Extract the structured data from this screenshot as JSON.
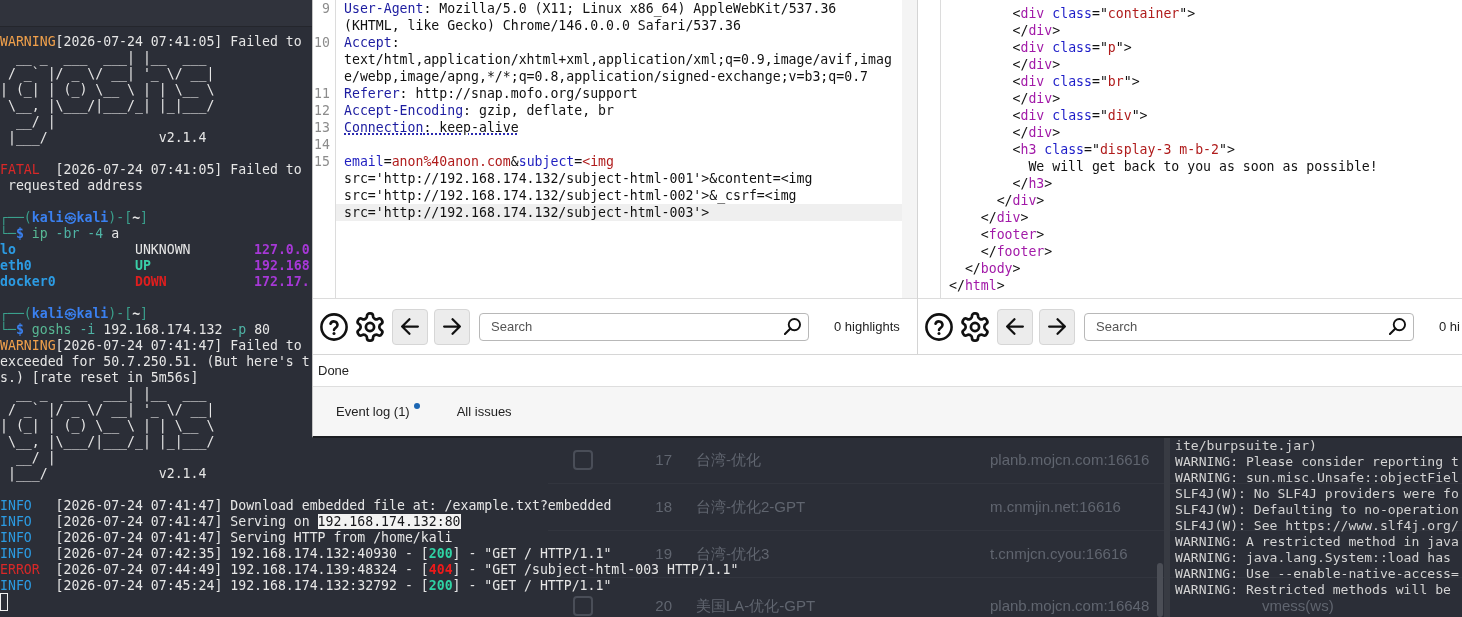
{
  "left_terminal": {
    "lines": [
      {
        "kind": "text",
        "segments": [
          {
            "kind": "warning",
            "text": "WARNING"
          },
          {
            "kind": "plain",
            "text": "[2026-07-24 07:41:05] Failed to"
          }
        ]
      },
      {
        "kind": "text",
        "segments": [
          {
            "kind": "plain",
            "text": "  __ _  ___  ___| |__  ___"
          }
        ]
      },
      {
        "kind": "text",
        "segments": [
          {
            "kind": "plain",
            "text": " / _` |/ _ \\/ __| '_ \\/ __|"
          }
        ]
      },
      {
        "kind": "text",
        "segments": [
          {
            "kind": "plain",
            "text": "| (_| | (_) \\__ \\ | | \\__ \\"
          }
        ]
      },
      {
        "kind": "text",
        "segments": [
          {
            "kind": "plain",
            "text": " \\__, |\\___/|___/_| |_|___/"
          }
        ]
      },
      {
        "kind": "text",
        "segments": [
          {
            "kind": "plain",
            "text": "  __/ |"
          }
        ]
      },
      {
        "kind": "text",
        "segments": [
          {
            "kind": "plain",
            "text": " |___/              v2.1.4"
          }
        ]
      },
      {
        "kind": "blank"
      },
      {
        "kind": "text",
        "segments": [
          {
            "kind": "fatal",
            "text": "FATAL"
          },
          {
            "kind": "plain",
            "text": "  [2026-07-24 07:41:05] Failed to"
          }
        ]
      },
      {
        "kind": "text",
        "segments": [
          {
            "kind": "plain",
            "text": " requested address"
          }
        ]
      },
      {
        "kind": "blank"
      },
      {
        "kind": "text",
        "segments": [
          {
            "kind": "frame",
            "text": "┌──("
          },
          {
            "kind": "host",
            "text": "kali㉿kali"
          },
          {
            "kind": "frame",
            "text": ")-["
          },
          {
            "kind": "cwd",
            "text": "~"
          },
          {
            "kind": "frame",
            "text": "]"
          }
        ]
      },
      {
        "kind": "text",
        "segments": [
          {
            "kind": "frame",
            "text": "└─"
          },
          {
            "kind": "dollar",
            "text": "$ "
          },
          {
            "kind": "command",
            "text": "ip"
          },
          {
            "kind": "option",
            "text": " -br -4"
          },
          {
            "kind": "plain",
            "text": " a"
          }
        ]
      },
      {
        "kind": "text",
        "segments": [
          {
            "kind": "iface",
            "text": "lo"
          },
          {
            "kind": "plain",
            "text": "               UNKNOWN        "
          },
          {
            "kind": "address",
            "text": "127.0.0"
          }
        ]
      },
      {
        "kind": "text",
        "segments": [
          {
            "kind": "iface",
            "text": "eth0             "
          },
          {
            "kind": "up",
            "text": "UP             "
          },
          {
            "kind": "address",
            "text": "192.168"
          }
        ]
      },
      {
        "kind": "text",
        "segments": [
          {
            "kind": "iface",
            "text": "docker0          "
          },
          {
            "kind": "down",
            "text": "DOWN           "
          },
          {
            "kind": "address",
            "text": "172.17."
          }
        ]
      },
      {
        "kind": "blank"
      },
      {
        "kind": "text",
        "segments": [
          {
            "kind": "frame",
            "text": "┌──("
          },
          {
            "kind": "host",
            "text": "kali㉿kali"
          },
          {
            "kind": "frame",
            "text": ")-["
          },
          {
            "kind": "cwd",
            "text": "~"
          },
          {
            "kind": "frame",
            "text": "]"
          }
        ]
      },
      {
        "kind": "text",
        "segments": [
          {
            "kind": "frame",
            "text": "└─"
          },
          {
            "kind": "dollar",
            "text": "$ "
          },
          {
            "kind": "command",
            "text": "goshs"
          },
          {
            "kind": "option",
            "text": " -i"
          },
          {
            "kind": "plain",
            "text": " 192.168.174.132"
          },
          {
            "kind": "option",
            "text": " -p"
          },
          {
            "kind": "plain",
            "text": " 80"
          }
        ]
      },
      {
        "kind": "text",
        "segments": [
          {
            "kind": "warning",
            "text": "WARNING"
          },
          {
            "kind": "plain",
            "text": "[2026-07-24 07:41:47] Failed to"
          }
        ]
      },
      {
        "kind": "text",
        "segments": [
          {
            "kind": "plain",
            "text": "exceeded for 50.7.250.51. (But here's t"
          }
        ]
      },
      {
        "kind": "text",
        "segments": [
          {
            "kind": "plain",
            "text": "s.) [rate reset in 5m56s]"
          }
        ]
      },
      {
        "kind": "text",
        "segments": [
          {
            "kind": "plain",
            "text": "  __ _  ___  ___| |__  ___"
          }
        ]
      },
      {
        "kind": "text",
        "segments": [
          {
            "kind": "plain",
            "text": " / _` |/ _ \\/ __| '_ \\/ __|"
          }
        ]
      },
      {
        "kind": "text",
        "segments": [
          {
            "kind": "plain",
            "text": "| (_| | (_) \\__ \\ | | \\__ \\"
          }
        ]
      },
      {
        "kind": "text",
        "segments": [
          {
            "kind": "plain",
            "text": " \\__, |\\___/|___/_| |_|___/"
          }
        ]
      },
      {
        "kind": "text",
        "segments": [
          {
            "kind": "plain",
            "text": "  __/ |"
          }
        ]
      },
      {
        "kind": "text",
        "segments": [
          {
            "kind": "plain",
            "text": " |___/              v2.1.4"
          }
        ]
      },
      {
        "kind": "blank"
      },
      {
        "kind": "text",
        "segments": [
          {
            "kind": "info",
            "text": "INFO"
          },
          {
            "kind": "plain",
            "text": "   [2026-07-24 07:41:47] Download embedded file at: /example.txt?embedded"
          }
        ]
      },
      {
        "kind": "text",
        "segments": [
          {
            "kind": "info",
            "text": "INFO"
          },
          {
            "kind": "plain",
            "text": "   [2026-07-24 07:41:47] Serving on "
          },
          {
            "kind": "selected",
            "text": "192.168.174.132:80"
          }
        ]
      },
      {
        "kind": "text",
        "segments": [
          {
            "kind": "info",
            "text": "INFO"
          },
          {
            "kind": "plain",
            "text": "   [2026-07-24 07:41:47] Serving HTTP from /home/kali"
          }
        ]
      },
      {
        "kind": "text",
        "segments": [
          {
            "kind": "info",
            "text": "INFO"
          },
          {
            "kind": "plain",
            "text": "   [2026-07-24 07:42:35] 192.168.174.132:40930 - ["
          },
          {
            "kind": "status_ok",
            "text": "200"
          },
          {
            "kind": "plain",
            "text": "] - \"GET / HTTP/1.1\""
          }
        ]
      },
      {
        "kind": "text",
        "segments": [
          {
            "kind": "error",
            "text": "ERROR"
          },
          {
            "kind": "plain",
            "text": "  [2026-07-24 07:44:49] 192.168.174.139:48324 - ["
          },
          {
            "kind": "status_error",
            "text": "404"
          },
          {
            "kind": "plain",
            "text": "] - \"GET /subject-html-003 HTTP/1.1\""
          }
        ]
      },
      {
        "kind": "text",
        "segments": [
          {
            "kind": "info",
            "text": "INFO"
          },
          {
            "kind": "plain",
            "text": "   [2026-07-24 07:45:24] 192.168.174.132:32792 - ["
          },
          {
            "kind": "status_ok",
            "text": "200"
          },
          {
            "kind": "plain",
            "text": "] - \"GET / HTTP/1.1\""
          }
        ]
      },
      {
        "kind": "cursor"
      }
    ]
  },
  "burp_window": {
    "panes": [
      {
        "kind": "request",
        "lines": [
          {
            "number": "9",
            "underlined": false,
            "current": false,
            "segments": [
              {
                "kind": "key",
                "text": "User-Agent"
              },
              {
                "kind": "plain",
                "text": ": Mozilla/5.0 (X11; Linux x86_64) AppleWebKit/537.36 (KHTML, like Gecko) Chrome/146.0.0.0 Safari/537.36"
              }
            ]
          },
          {
            "number": "10",
            "underlined": false,
            "current": false,
            "segments": [
              {
                "kind": "key",
                "text": "Accept"
              },
              {
                "kind": "plain",
                "text": ": text/html,application/xhtml+xml,application/xml;q=0.9,image/avif,image/webp,image/apng,*/*;q=0.8,application/signed-exchange;v=b3;q=0.7"
              }
            ]
          },
          {
            "number": "11",
            "underlined": false,
            "current": false,
            "segments": [
              {
                "kind": "key",
                "text": "Referer"
              },
              {
                "kind": "plain",
                "text": ": http://snap.mofo.org/support"
              }
            ]
          },
          {
            "number": "12",
            "underlined": false,
            "current": false,
            "segments": [
              {
                "kind": "key",
                "text": "Accept-Encoding"
              },
              {
                "kind": "plain",
                "text": ": gzip, deflate, br"
              }
            ]
          },
          {
            "number": "13",
            "underlined": true,
            "current": false,
            "segments": [
              {
                "kind": "key",
                "text": "Connection"
              },
              {
                "kind": "plain",
                "text": ": keep-alive"
              }
            ]
          },
          {
            "number": "14",
            "current": false
          },
          {
            "number": "15",
            "underlined": false,
            "current": true,
            "segments": [
              {
                "kind": "param_name",
                "text": "email"
              },
              {
                "kind": "plain",
                "text": "="
              },
              {
                "kind": "param_value",
                "text": "anon%40anon.com"
              },
              {
                "kind": "plain",
                "text": "&"
              },
              {
                "kind": "param_name",
                "text": "subject"
              },
              {
                "kind": "plain",
                "text": "="
              },
              {
                "kind": "param_value",
                "text": "<img"
              },
              {
                "kind": "plain",
                "text": " src='http://192.168.174.132/subject-html-001'>&content=<img src='http://192.168.174.132/subject-html-002'>&_csrf=<img src='http://192.168.174.132/subject-html-003'>"
              }
            ]
          }
        ],
        "toolbar": {
          "search_placeholder": "Search",
          "highlights": "0 highlights"
        }
      },
      {
        "kind": "response",
        "lines": [
          {
            "segments": [
              {
                "kind": "punct",
                "text": "        <"
              },
              {
                "kind": "tag",
                "text": "div"
              },
              {
                "kind": "attr",
                "text": " class"
              },
              {
                "kind": "punct",
                "text": "=\""
              },
              {
                "kind": "value",
                "text": "container"
              },
              {
                "kind": "punct",
                "text": "\">"
              }
            ]
          },
          {
            "segments": [
              {
                "kind": "punct",
                "text": "        </"
              },
              {
                "kind": "tag",
                "text": "div"
              },
              {
                "kind": "punct",
                "text": ">"
              }
            ]
          },
          {
            "segments": [
              {
                "kind": "punct",
                "text": "        <"
              },
              {
                "kind": "tag",
                "text": "div"
              },
              {
                "kind": "attr",
                "text": " class"
              },
              {
                "kind": "punct",
                "text": "=\""
              },
              {
                "kind": "value",
                "text": "p"
              },
              {
                "kind": "punct",
                "text": "\">"
              }
            ]
          },
          {
            "segments": [
              {
                "kind": "punct",
                "text": "        </"
              },
              {
                "kind": "tag",
                "text": "div"
              },
              {
                "kind": "punct",
                "text": ">"
              }
            ]
          },
          {
            "segments": [
              {
                "kind": "punct",
                "text": "        <"
              },
              {
                "kind": "tag",
                "text": "div"
              },
              {
                "kind": "attr",
                "text": " class"
              },
              {
                "kind": "punct",
                "text": "=\""
              },
              {
                "kind": "value",
                "text": "br"
              },
              {
                "kind": "punct",
                "text": "\">"
              }
            ]
          },
          {
            "segments": [
              {
                "kind": "punct",
                "text": "        </"
              },
              {
                "kind": "tag",
                "text": "div"
              },
              {
                "kind": "punct",
                "text": ">"
              }
            ]
          },
          {
            "segments": [
              {
                "kind": "punct",
                "text": "        <"
              },
              {
                "kind": "tag",
                "text": "div"
              },
              {
                "kind": "attr",
                "text": " class"
              },
              {
                "kind": "punct",
                "text": "=\""
              },
              {
                "kind": "value",
                "text": "div"
              },
              {
                "kind": "punct",
                "text": "\">"
              }
            ]
          },
          {
            "segments": [
              {
                "kind": "punct",
                "text": "        </"
              },
              {
                "kind": "tag",
                "text": "div"
              },
              {
                "kind": "punct",
                "text": ">"
              }
            ]
          },
          {
            "segments": [
              {
                "kind": "punct",
                "text": "        <"
              },
              {
                "kind": "tag",
                "text": "h3"
              },
              {
                "kind": "attr",
                "text": " class"
              },
              {
                "kind": "punct",
                "text": "=\""
              },
              {
                "kind": "value",
                "text": "display-3 m-b-2"
              },
              {
                "kind": "punct",
                "text": "\">"
              }
            ]
          },
          {
            "segments": [
              {
                "kind": "text",
                "text": "          We will get back to you as soon as possible!"
              }
            ]
          },
          {
            "segments": [
              {
                "kind": "punct",
                "text": "        </"
              },
              {
                "kind": "tag",
                "text": "h3"
              },
              {
                "kind": "punct",
                "text": ">"
              }
            ]
          },
          {
            "segments": [
              {
                "kind": "punct",
                "text": "      </"
              },
              {
                "kind": "tag",
                "text": "div"
              },
              {
                "kind": "punct",
                "text": ">"
              }
            ]
          },
          {
            "segments": [
              {
                "kind": "punct",
                "text": "    </"
              },
              {
                "kind": "tag",
                "text": "div"
              },
              {
                "kind": "punct",
                "text": ">"
              }
            ]
          },
          {
            "segments": [
              {
                "kind": "punct",
                "text": "    <"
              },
              {
                "kind": "tag",
                "text": "footer"
              },
              {
                "kind": "punct",
                "text": ">"
              }
            ]
          },
          {
            "segments": [
              {
                "kind": "punct",
                "text": "    </"
              },
              {
                "kind": "tag",
                "text": "footer"
              },
              {
                "kind": "punct",
                "text": ">"
              }
            ]
          },
          {
            "segments": [
              {
                "kind": "punct",
                "text": "  </"
              },
              {
                "kind": "tag",
                "text": "body"
              },
              {
                "kind": "punct",
                "text": ">"
              }
            ]
          },
          {
            "segments": [
              {
                "kind": "punct",
                "text": "</"
              },
              {
                "kind": "tag",
                "text": "html"
              },
              {
                "kind": "punct",
                "text": ">"
              }
            ]
          }
        ],
        "toolbar": {
          "search_placeholder": "Search",
          "highlights": "0 hi"
        }
      }
    ],
    "status": "Done",
    "bottom_tabs": [
      {
        "label": "Event log (1)",
        "notification": true
      },
      {
        "label": "All issues",
        "notification": false
      }
    ]
  },
  "background_window": {
    "rows": [
      {
        "checked": false,
        "column_1": "17",
        "column_2": "台湾-优化",
        "column_3": "planb.mojcn.com:16616"
      },
      {
        "column_1": "18",
        "column_2": "台湾-优化2-GPT",
        "column_3": "m.cnmjin.net:16616"
      },
      {
        "column_1": "19",
        "column_2": "台湾-优化3",
        "column_3": "t.cnmjcn.cyou:16616"
      },
      {
        "checked": false,
        "column_1": "20",
        "column_2": "美国LA-优化-GPT",
        "column_3": "planb.mojcn.com:16648",
        "column_4": "vmess(ws)"
      }
    ]
  },
  "right_terminal": {
    "lines": [
      "ite/burpsuite.jar)",
      "WARNING: Please consider reporting t",
      "WARNING: sun.misc.Unsafe::objectFiel",
      "SLF4J(W): No SLF4J providers were fo",
      "SLF4J(W): Defaulting to no-operation",
      "SLF4J(W): See https://www.slf4j.org/",
      "WARNING: A restricted method in java",
      "WARNING: java.lang.System::load has",
      "WARNING: Use --enable-native-access=",
      "WARNING: Restricted methods will be"
    ]
  }
}
